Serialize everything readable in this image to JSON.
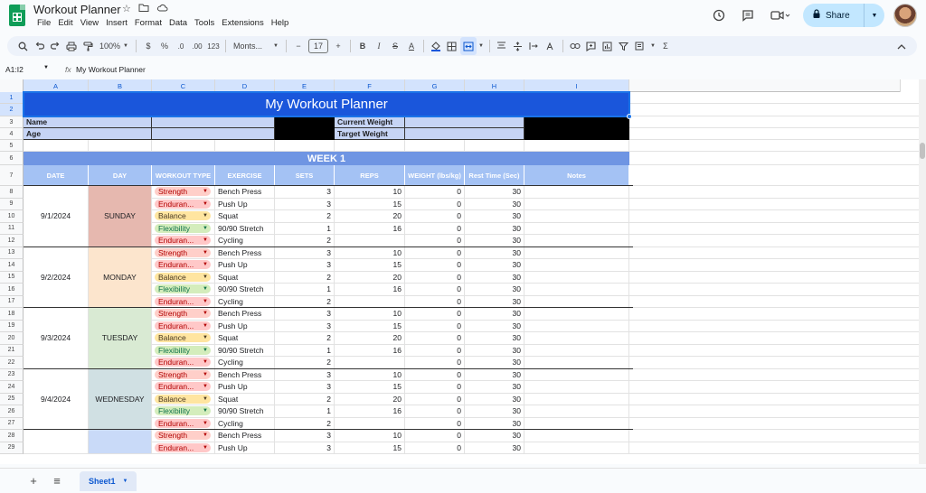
{
  "app": {
    "title": "Workout Planner",
    "menu": [
      "File",
      "Edit",
      "View",
      "Insert",
      "Format",
      "Data",
      "Tools",
      "Extensions",
      "Help"
    ],
    "share_label": "Share"
  },
  "toolbar": {
    "zoom": "100%",
    "currency": "$",
    "percent": "%",
    "dec_less": ".0",
    "dec_more": ".00",
    "num_format": "123",
    "font": "Monts...",
    "font_size": "17",
    "minus": "−",
    "plus": "+",
    "bold": "B",
    "italic": "I",
    "strike": "S",
    "text_color": "A",
    "sigma": "Σ"
  },
  "formula_bar": {
    "name_box": "A1:I2",
    "fx": "fx",
    "content": "My Workout Planner"
  },
  "grid": {
    "columns": [
      "A",
      "B",
      "C",
      "D",
      "E",
      "F",
      "G",
      "H",
      "I"
    ],
    "rows": [
      "1",
      "2",
      "3",
      "4",
      "5",
      "6",
      "7",
      "8",
      "9",
      "10",
      "11",
      "12",
      "13",
      "14",
      "15",
      "16",
      "17",
      "18",
      "19",
      "20",
      "21",
      "22",
      "23",
      "24",
      "25",
      "26",
      "27",
      "28",
      "29"
    ],
    "selected_columns": [
      "A",
      "B",
      "C",
      "D",
      "E",
      "F",
      "G",
      "H",
      "I"
    ],
    "selected_rows": [
      "1",
      "2"
    ]
  },
  "sheet": {
    "banner": "My Workout Planner",
    "name_label": "Name",
    "age_label": "Age",
    "current_weight_label": "Current Weight",
    "target_weight_label": "Target Weight",
    "week_label": "WEEK 1",
    "headers": {
      "date": "DATE",
      "day": "DAY",
      "type": "WORKOUT TYPE",
      "exercise": "EXERCISE",
      "sets": "SETS",
      "reps": "REPS",
      "weight": "WEIGHT (lbs/kg)",
      "rest": "Rest Time (Sec)",
      "notes": "Notes"
    },
    "days": [
      {
        "date": "9/1/2024",
        "day": "SUNDAY",
        "entries": [
          {
            "type": "Strength",
            "exercise": "Bench Press",
            "sets": "3",
            "reps": "10",
            "weight": "0",
            "rest": "30"
          },
          {
            "type": "Enduran...",
            "exercise": "Push Up",
            "sets": "3",
            "reps": "15",
            "weight": "0",
            "rest": "30"
          },
          {
            "type": "Balance",
            "exercise": "Squat",
            "sets": "2",
            "reps": "20",
            "weight": "0",
            "rest": "30"
          },
          {
            "type": "Flexibility",
            "exercise": "90/90 Stretch",
            "sets": "1",
            "reps": "16",
            "weight": "0",
            "rest": "30"
          },
          {
            "type": "Enduran...",
            "exercise": "Cycling",
            "sets": "2",
            "reps": "",
            "weight": "0",
            "rest": "30"
          }
        ]
      },
      {
        "date": "9/2/2024",
        "day": "MONDAY",
        "entries": [
          {
            "type": "Strength",
            "exercise": "Bench Press",
            "sets": "3",
            "reps": "10",
            "weight": "0",
            "rest": "30"
          },
          {
            "type": "Enduran...",
            "exercise": "Push Up",
            "sets": "3",
            "reps": "15",
            "weight": "0",
            "rest": "30"
          },
          {
            "type": "Balance",
            "exercise": "Squat",
            "sets": "2",
            "reps": "20",
            "weight": "0",
            "rest": "30"
          },
          {
            "type": "Flexibility",
            "exercise": "90/90 Stretch",
            "sets": "1",
            "reps": "16",
            "weight": "0",
            "rest": "30"
          },
          {
            "type": "Enduran...",
            "exercise": "Cycling",
            "sets": "2",
            "reps": "",
            "weight": "0",
            "rest": "30"
          }
        ]
      },
      {
        "date": "9/3/2024",
        "day": "TUESDAY",
        "entries": [
          {
            "type": "Strength",
            "exercise": "Bench Press",
            "sets": "3",
            "reps": "10",
            "weight": "0",
            "rest": "30"
          },
          {
            "type": "Enduran...",
            "exercise": "Push Up",
            "sets": "3",
            "reps": "15",
            "weight": "0",
            "rest": "30"
          },
          {
            "type": "Balance",
            "exercise": "Squat",
            "sets": "2",
            "reps": "20",
            "weight": "0",
            "rest": "30"
          },
          {
            "type": "Flexibility",
            "exercise": "90/90 Stretch",
            "sets": "1",
            "reps": "16",
            "weight": "0",
            "rest": "30"
          },
          {
            "type": "Enduran...",
            "exercise": "Cycling",
            "sets": "2",
            "reps": "",
            "weight": "0",
            "rest": "30"
          }
        ]
      },
      {
        "date": "9/4/2024",
        "day": "WEDNESDAY",
        "entries": [
          {
            "type": "Strength",
            "exercise": "Bench Press",
            "sets": "3",
            "reps": "10",
            "weight": "0",
            "rest": "30"
          },
          {
            "type": "Enduran...",
            "exercise": "Push Up",
            "sets": "3",
            "reps": "15",
            "weight": "0",
            "rest": "30"
          },
          {
            "type": "Balance",
            "exercise": "Squat",
            "sets": "2",
            "reps": "20",
            "weight": "0",
            "rest": "30"
          },
          {
            "type": "Flexibility",
            "exercise": "90/90 Stretch",
            "sets": "1",
            "reps": "16",
            "weight": "0",
            "rest": "30"
          },
          {
            "type": "Enduran...",
            "exercise": "Cycling",
            "sets": "2",
            "reps": "",
            "weight": "0",
            "rest": "30"
          }
        ]
      },
      {
        "date": "",
        "day": "",
        "entries": [
          {
            "type": "Strength",
            "exercise": "Bench Press",
            "sets": "3",
            "reps": "10",
            "weight": "0",
            "rest": "30"
          },
          {
            "type": "Enduran...",
            "exercise": "Push Up",
            "sets": "3",
            "reps": "15",
            "weight": "0",
            "rest": "30"
          }
        ]
      }
    ]
  },
  "bottom": {
    "add_sheet": "+",
    "all_sheets": "≡",
    "active_sheet": "Sheet1"
  },
  "colors": {
    "banner": "#1a56db",
    "week_header": "#6f95e3",
    "column_header": "#a4c2f4",
    "label_fill": "#c6d4f5",
    "share_button": "#c2e7ff",
    "selection": "#1a73e8"
  },
  "icons": {
    "logo": "google-sheets-logo-icon",
    "star": "star-icon",
    "folder": "move-folder-icon",
    "cloud": "cloud-status-icon",
    "history": "version-history-icon",
    "comments": "comments-icon",
    "meet": "video-call-icon",
    "lock": "lock-icon"
  }
}
